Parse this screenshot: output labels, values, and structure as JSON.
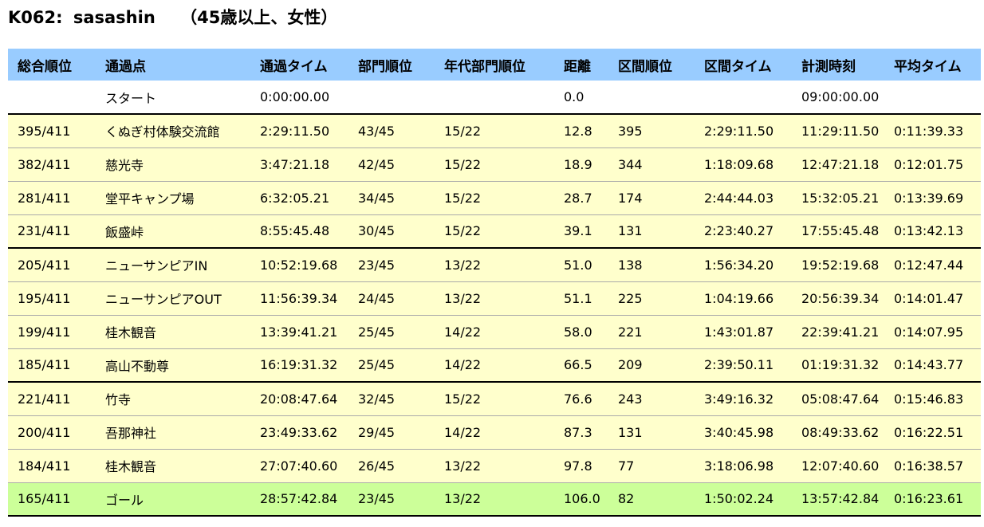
{
  "header": {
    "bib": "K062:",
    "name": "sasashin",
    "category": "（45歳以上、女性）"
  },
  "table": {
    "columns": [
      "総合順位",
      "通過点",
      "通過タイム",
      "部門順位",
      "年代部門順位",
      "距離",
      "区間順位",
      "区間タイム",
      "計測時刻",
      "平均タイム"
    ],
    "rows": [
      {
        "overall": "",
        "checkpoint": "スタート",
        "split": "0:00:00.00",
        "division": "",
        "age_division": "",
        "distance": "0.0",
        "section_rank": "",
        "section_time": "",
        "clock": "09:00:00.00",
        "avg": ""
      },
      {
        "overall": "395/411",
        "checkpoint": "くぬぎ村体験交流館",
        "split": "2:29:11.50",
        "division": "43/45",
        "age_division": "15/22",
        "distance": "12.8",
        "section_rank": "395",
        "section_time": "2:29:11.50",
        "clock": "11:29:11.50",
        "avg": "0:11:39.33"
      },
      {
        "overall": "382/411",
        "checkpoint": "慈光寺",
        "split": "3:47:21.18",
        "division": "42/45",
        "age_division": "15/22",
        "distance": "18.9",
        "section_rank": "344",
        "section_time": "1:18:09.68",
        "clock": "12:47:21.18",
        "avg": "0:12:01.75"
      },
      {
        "overall": "281/411",
        "checkpoint": "堂平キャンプ場",
        "split": "6:32:05.21",
        "division": "34/45",
        "age_division": "15/22",
        "distance": "28.7",
        "section_rank": "174",
        "section_time": "2:44:44.03",
        "clock": "15:32:05.21",
        "avg": "0:13:39.69"
      },
      {
        "overall": "231/411",
        "checkpoint": "飯盛峠",
        "split": "8:55:45.48",
        "division": "30/45",
        "age_division": "15/22",
        "distance": "39.1",
        "section_rank": "131",
        "section_time": "2:23:40.27",
        "clock": "17:55:45.48",
        "avg": "0:13:42.13"
      },
      {
        "overall": "205/411",
        "checkpoint": "ニューサンピアIN",
        "split": "10:52:19.68",
        "division": "23/45",
        "age_division": "13/22",
        "distance": "51.0",
        "section_rank": "138",
        "section_time": "1:56:34.20",
        "clock": "19:52:19.68",
        "avg": "0:12:47.44"
      },
      {
        "overall": "195/411",
        "checkpoint": "ニューサンピアOUT",
        "split": "11:56:39.34",
        "division": "24/45",
        "age_division": "13/22",
        "distance": "51.1",
        "section_rank": "225",
        "section_time": "1:04:19.66",
        "clock": "20:56:39.34",
        "avg": "0:14:01.47"
      },
      {
        "overall": "199/411",
        "checkpoint": "桂木観音",
        "split": "13:39:41.21",
        "division": "25/45",
        "age_division": "14/22",
        "distance": "58.0",
        "section_rank": "221",
        "section_time": "1:43:01.87",
        "clock": "22:39:41.21",
        "avg": "0:14:07.95"
      },
      {
        "overall": "185/411",
        "checkpoint": "高山不動尊",
        "split": "16:19:31.32",
        "division": "25/45",
        "age_division": "14/22",
        "distance": "66.5",
        "section_rank": "209",
        "section_time": "2:39:50.11",
        "clock": "01:19:31.32",
        "avg": "0:14:43.77"
      },
      {
        "overall": "221/411",
        "checkpoint": "竹寺",
        "split": "20:08:47.64",
        "division": "32/45",
        "age_division": "15/22",
        "distance": "76.6",
        "section_rank": "243",
        "section_time": "3:49:16.32",
        "clock": "05:08:47.64",
        "avg": "0:15:46.83"
      },
      {
        "overall": "200/411",
        "checkpoint": "吾那神社",
        "split": "23:49:33.62",
        "division": "29/45",
        "age_division": "14/22",
        "distance": "87.3",
        "section_rank": "131",
        "section_time": "3:40:45.98",
        "clock": "08:49:33.62",
        "avg": "0:16:22.51"
      },
      {
        "overall": "184/411",
        "checkpoint": "桂木観音",
        "split": "27:07:40.60",
        "division": "26/45",
        "age_division": "13/22",
        "distance": "97.8",
        "section_rank": "77",
        "section_time": "3:18:06.98",
        "clock": "12:07:40.60",
        "avg": "0:16:38.57"
      },
      {
        "overall": "165/411",
        "checkpoint": "ゴール",
        "split": "28:57:42.84",
        "division": "23/45",
        "age_division": "13/22",
        "distance": "106.0",
        "section_rank": "82",
        "section_time": "1:50:02.24",
        "clock": "13:57:42.84",
        "avg": "0:16:23.61"
      }
    ]
  },
  "colors": {
    "header_bg": "#99ccff",
    "row_bg": "#ffffcc",
    "goal_bg": "#ccff99"
  }
}
